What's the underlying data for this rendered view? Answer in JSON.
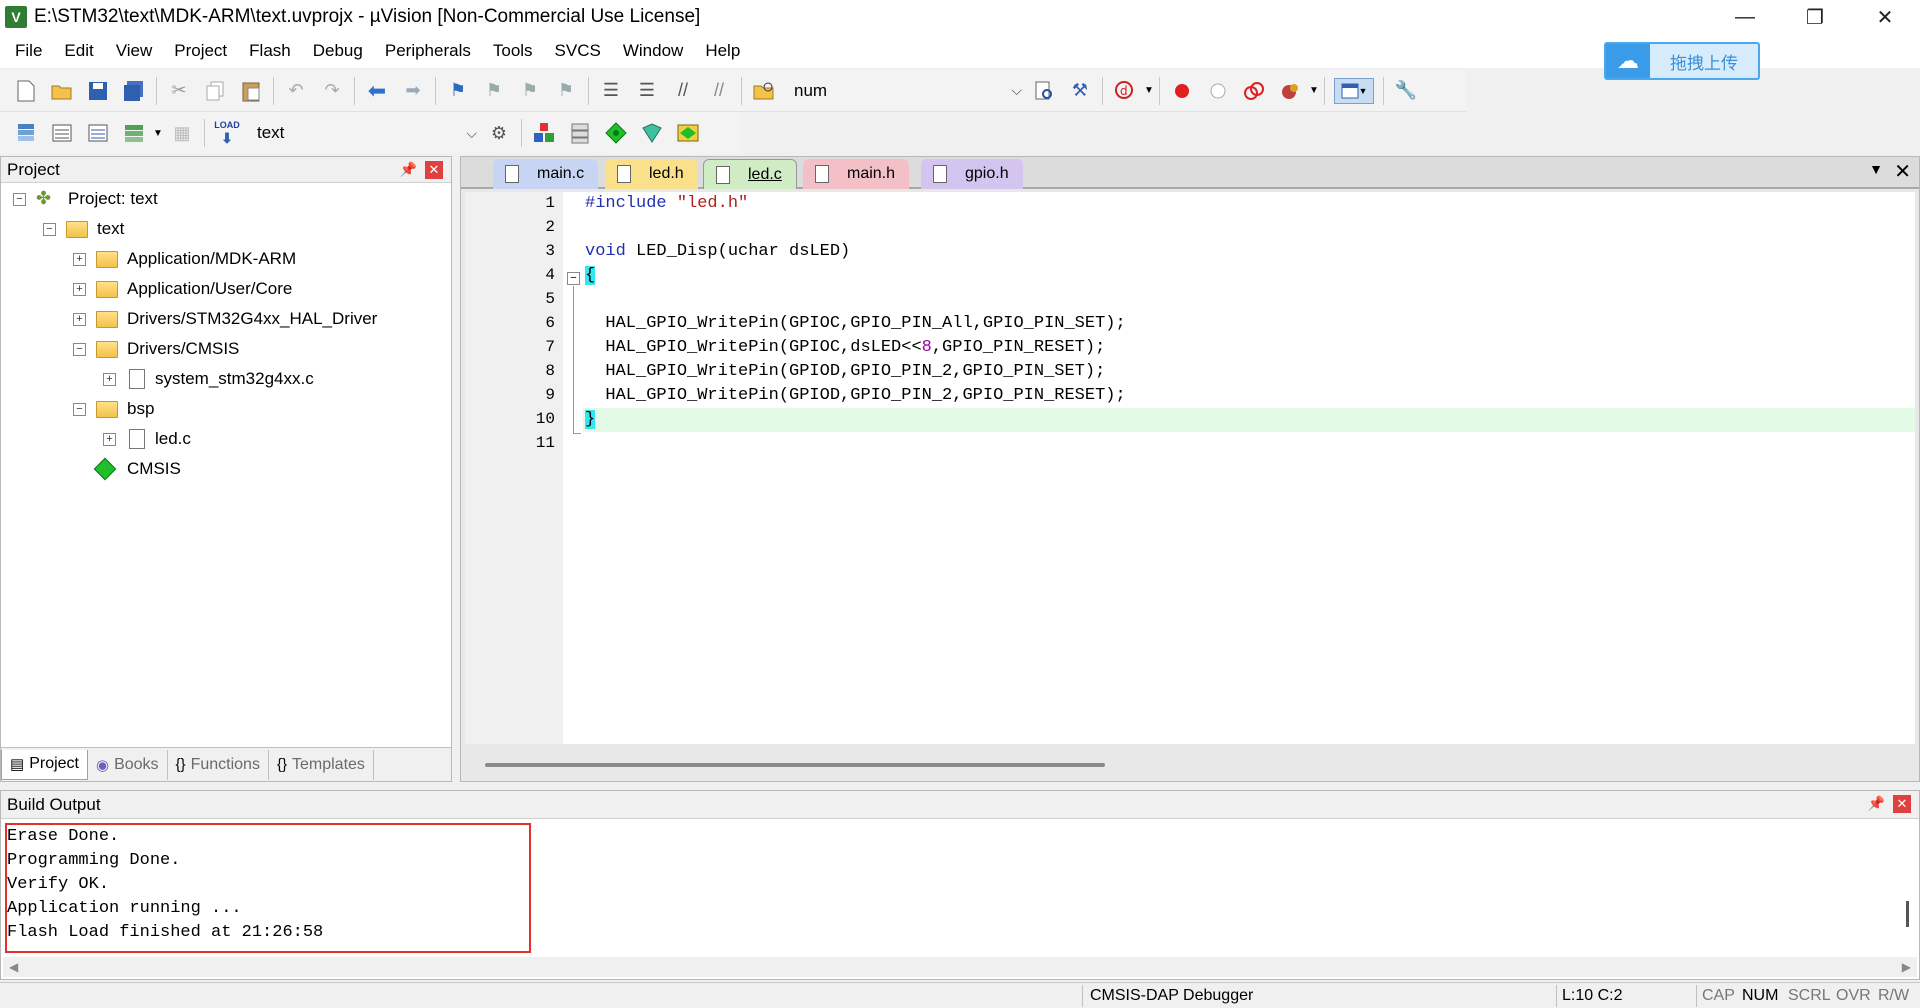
{
  "window": {
    "title": "E:\\STM32\\text\\MDK-ARM\\text.uvprojx - µVision  [Non-Commercial Use License]",
    "app_icon": "V",
    "minimize_glyph": "—",
    "maximize_glyph": "❐",
    "close_glyph": "✕"
  },
  "menu": [
    "File",
    "Edit",
    "View",
    "Project",
    "Flash",
    "Debug",
    "Peripherals",
    "Tools",
    "SVCS",
    "Window",
    "Help"
  ],
  "upload_button": {
    "label": "拖拽上传",
    "icon": "cloud-icon"
  },
  "toolbar1": {
    "find_combo_value": "num"
  },
  "toolbar2": {
    "target_combo_value": "text",
    "load_label": "LOAD"
  },
  "project_panel": {
    "title": "Project",
    "tree": [
      {
        "label": "Project: text",
        "expander": "−",
        "icon": "project-icon"
      },
      {
        "label": "text",
        "expander": "−",
        "icon": "target-folder-icon"
      },
      {
        "label": "Application/MDK-ARM",
        "expander": "+",
        "icon": "folder-icon"
      },
      {
        "label": "Application/User/Core",
        "expander": "+",
        "icon": "folder-icon"
      },
      {
        "label": "Drivers/STM32G4xx_HAL_Driver",
        "expander": "+",
        "icon": "folder-icon"
      },
      {
        "label": "Drivers/CMSIS",
        "expander": "−",
        "icon": "folder-icon"
      },
      {
        "label": "system_stm32g4xx.c",
        "expander": "+",
        "icon": "file-icon"
      },
      {
        "label": "bsp",
        "expander": "−",
        "icon": "folder-icon"
      },
      {
        "label": "led.c",
        "expander": "+",
        "icon": "file-icon"
      },
      {
        "label": "CMSIS",
        "expander": "",
        "icon": "diamond-icon"
      }
    ],
    "tabs": [
      {
        "label": "Project",
        "icon": "project-tab-icon"
      },
      {
        "label": "Books",
        "icon": "books-icon"
      },
      {
        "label": "Functions",
        "icon": "{}"
      },
      {
        "label": "Templates",
        "icon": "{}"
      }
    ]
  },
  "editor": {
    "tabs": [
      {
        "label": "main.c",
        "color": "#c8d4f4"
      },
      {
        "label": "led.h",
        "color": "#fbe08c"
      },
      {
        "label": "led.c",
        "color": "#d0ecc4",
        "active": true
      },
      {
        "label": "main.h",
        "color": "#f4c0c8"
      },
      {
        "label": "gpio.h",
        "color": "#d4c4f0"
      }
    ],
    "line_numbers": [
      "1",
      "2",
      "3",
      "4",
      "5",
      "6",
      "7",
      "8",
      "9",
      "10",
      "11"
    ],
    "code": {
      "l1_pp": "#include",
      "l1_str": "\"led.h\"",
      "l3_kw": "void",
      "l3_rest": " LED_Disp(uchar dsLED)",
      "l4": "{",
      "l6": "  HAL_GPIO_WritePin(GPIOC,GPIO_PIN_All,GPIO_PIN_SET);",
      "l7_a": "  HAL_GPIO_WritePin(GPIOC,dsLED<<",
      "l7_num": "8",
      "l7_b": ",GPIO_PIN_RESET);",
      "l8": "  HAL_GPIO_WritePin(GPIOD,GPIO_PIN_2,GPIO_PIN_SET);",
      "l9": "  HAL_GPIO_WritePin(GPIOD,GPIO_PIN_2,GPIO_PIN_RESET);",
      "l10": "}"
    }
  },
  "build_output": {
    "title": "Build Output",
    "lines": [
      "Erase Done.",
      "Programming Done.",
      "Verify OK.",
      "Application running ...",
      "Flash Load finished at 21:26:58"
    ]
  },
  "status_bar": {
    "debugger": "CMSIS-DAP Debugger",
    "cursor": "L:10 C:2",
    "cap": "CAP",
    "num": "NUM",
    "scrl": "SCRL",
    "ovr": "OVR",
    "rw": "R/W"
  },
  "colors": {
    "highlight_line": "#e3fae6",
    "brace_match": "#35e6f0",
    "error_box": "#e03030",
    "keyword": "#2030b0",
    "string": "#b02020"
  }
}
